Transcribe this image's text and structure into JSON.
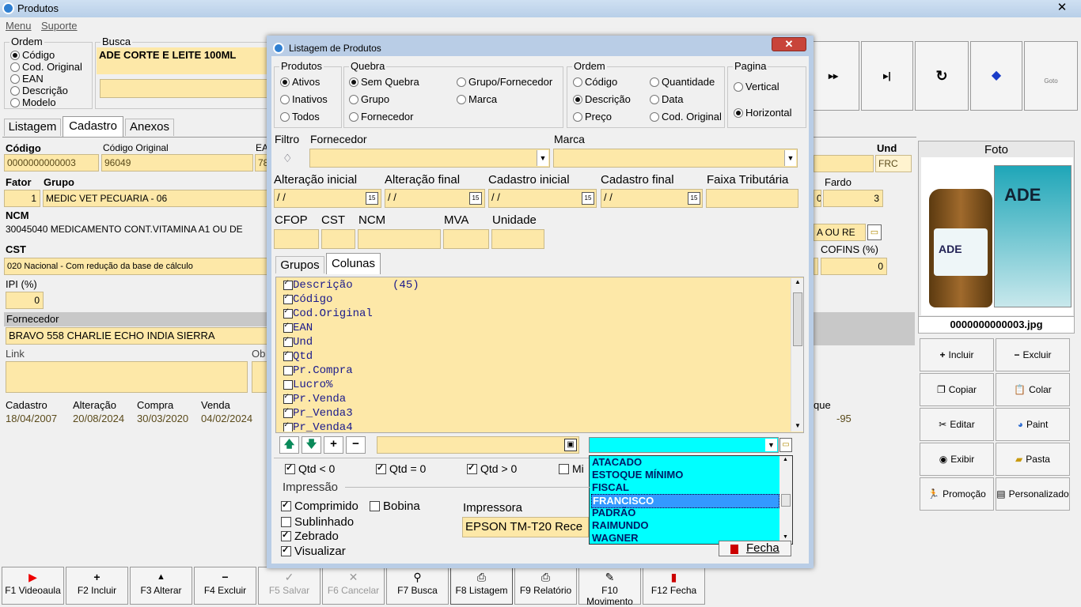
{
  "main": {
    "title": "Produtos",
    "menu": [
      "Menu",
      "Suporte"
    ],
    "ordem": {
      "label": "Ordem",
      "options": [
        "Código",
        "Cod. Original",
        "EAN",
        "Descrição",
        "Modelo"
      ],
      "selected": 0
    },
    "busca": {
      "label": "Busca",
      "value": "ADE CORTE E LEITE 100ML"
    },
    "tabs": [
      "Listagem",
      "Cadastro",
      "Anexos"
    ],
    "active_tab": 1,
    "fields": {
      "codigo": {
        "label": "Código",
        "value": "0000000000003"
      },
      "codigo_original": {
        "label": "Código Original",
        "value": "96049"
      },
      "ean": {
        "label": "EA",
        "value": "78"
      },
      "und": {
        "label": "Und",
        "value": "FRC"
      },
      "fator": {
        "label": "Fator",
        "value": "1"
      },
      "grupo": {
        "label": "Grupo",
        "value": "MEDIC VET PECUARIA - 06"
      },
      "fardo": {
        "label": "Fardo",
        "value": "3",
        "left_value": "0"
      },
      "ncm": {
        "label": "NCM",
        "value": "30045040 MEDICAMENTO CONT.VITAMINA A1 OU DE"
      },
      "ncm_right": "A OU RE",
      "cst": {
        "label": "CST",
        "value": "020 Nacional - Com redução da base de cálculo"
      },
      "cofins": {
        "label": "COFINS (%)",
        "value": "0"
      },
      "ipi": {
        "label": "IPI (%)",
        "value": "0"
      },
      "fornecedor": {
        "label": "Fornecedor",
        "value": "BRAVO 558 CHARLIE ECHO INDIA SIERRA"
      },
      "link": {
        "label": "Link",
        "value": ""
      },
      "obs_label": "Ob",
      "cadastro": {
        "label": "Cadastro",
        "value": "18/04/2007"
      },
      "alteracao": {
        "label": "Alteração",
        "value": "20/08/2024"
      },
      "compra": {
        "label": "Compra",
        "value": "30/03/2020"
      },
      "venda": {
        "label": "Venda",
        "value": "04/02/2024"
      },
      "estoque": {
        "label": "que",
        "value": "-95"
      }
    },
    "foto": {
      "label": "Foto",
      "filename": "0000000000003.jpg",
      "product_text": "ADE"
    },
    "foto_buttons": [
      {
        "label": "Incluir",
        "icon": "plus-icon"
      },
      {
        "label": "Excluir",
        "icon": "minus-icon"
      },
      {
        "label": "Copiar",
        "icon": "copy-icon"
      },
      {
        "label": "Colar",
        "icon": "paste-icon"
      },
      {
        "label": "Editar",
        "icon": "scissors-icon"
      },
      {
        "label": "Paint",
        "icon": "palette-icon"
      },
      {
        "label": "Exibir",
        "icon": "eye-icon"
      },
      {
        "label": "Pasta",
        "icon": "folder-icon"
      },
      {
        "label": "Promoção",
        "icon": "runner-icon"
      },
      {
        "label": "Personalizado",
        "icon": "card-icon"
      }
    ],
    "nav_buttons": [
      {
        "icon": "next-icon",
        "glyph": "▸▸"
      },
      {
        "icon": "last-icon",
        "glyph": "▸|"
      },
      {
        "icon": "refresh-icon",
        "glyph": "↻"
      },
      {
        "icon": "eraser-icon",
        "glyph": "◆"
      },
      {
        "icon": "goto-icon",
        "glyph": "Goto"
      }
    ],
    "function_keys": [
      {
        "label": "F1 Videoaula",
        "icon": "▶",
        "enabled": true
      },
      {
        "label": "F2 Incluir",
        "icon": "+",
        "enabled": true
      },
      {
        "label": "F3 Alterar",
        "icon": "▲",
        "enabled": true
      },
      {
        "label": "F4 Excluir",
        "icon": "−",
        "enabled": true
      },
      {
        "label": "F5 Salvar",
        "icon": "✓",
        "enabled": false
      },
      {
        "label": "F6 Cancelar",
        "icon": "✕",
        "enabled": false
      },
      {
        "label": "F7 Busca",
        "icon": "⚲",
        "enabled": true
      },
      {
        "label": "F8 Listagem",
        "icon": "⎙",
        "enabled": true
      },
      {
        "label": "F9 Relatório",
        "icon": "⎙",
        "enabled": true
      },
      {
        "label": "F10 Movimento",
        "icon": "✎",
        "enabled": true
      },
      {
        "label": "F12 Fecha",
        "icon": "▮",
        "enabled": true
      }
    ]
  },
  "dialog": {
    "title": "Listagem de Produtos",
    "produtos": {
      "label": "Produtos",
      "options": [
        "Ativos",
        "Inativos",
        "Todos"
      ],
      "selected": 0
    },
    "quebra": {
      "label": "Quebra",
      "options": [
        "Sem Quebra",
        "Grupo",
        "Fornecedor",
        "Grupo/Fornecedor",
        "Marca"
      ],
      "selected": 0
    },
    "ordem": {
      "label": "Ordem",
      "options": [
        "Código",
        "Descrição",
        "Preço",
        "Quantidade",
        "Data",
        "Cod. Original"
      ],
      "selected": 1
    },
    "pagina": {
      "label": "Pagina",
      "options": [
        "Vertical",
        "Horizontal"
      ],
      "selected": 1
    },
    "filtro_label": "Filtro",
    "fornecedor_label": "Fornecedor",
    "marca_label": "Marca",
    "date_fields": [
      {
        "label": "Alteração inicial",
        "value": "/ /"
      },
      {
        "label": "Alteração final",
        "value": "/ /"
      },
      {
        "label": "Cadastro inicial",
        "value": "/ /"
      },
      {
        "label": "Cadastro final",
        "value": "/ /"
      }
    ],
    "faixa_label": "Faixa Tributária",
    "small_fields": [
      "CFOP",
      "CST",
      "NCM",
      "MVA",
      "Unidade"
    ],
    "tabs": [
      "Grupos",
      "Colunas"
    ],
    "active_tab": 1,
    "columns": [
      {
        "label": "Descrição      (45)",
        "checked": true
      },
      {
        "label": "Código",
        "checked": true
      },
      {
        "label": "Cod.Original",
        "checked": true
      },
      {
        "label": "EAN",
        "checked": true
      },
      {
        "label": "Und",
        "checked": true
      },
      {
        "label": "Qtd",
        "checked": true
      },
      {
        "label": "Pr.Compra",
        "checked": false
      },
      {
        "label": "Lucro%",
        "checked": false
      },
      {
        "label": "Pr.Venda",
        "checked": true
      },
      {
        "label": "Pr_Venda3",
        "checked": true
      },
      {
        "label": "Pr_Venda4",
        "checked": true
      }
    ],
    "qtd_filters": [
      {
        "label": "Qtd < 0",
        "checked": true
      },
      {
        "label": "Qtd = 0",
        "checked": true
      },
      {
        "label": "Qtd > 0",
        "checked": true
      },
      {
        "label": "Mi",
        "checked": false
      }
    ],
    "impressao": {
      "label": "Impressão",
      "options": [
        {
          "label": "Comprimido",
          "checked": true
        },
        {
          "label": "Bobina",
          "checked": false
        },
        {
          "label": "Sublinhado",
          "checked": false
        },
        {
          "label": "Zebrado",
          "checked": true
        },
        {
          "label": "Visualizar",
          "checked": true
        }
      ]
    },
    "impressora": {
      "label": "Impressora",
      "value": "EPSON TM-T20 Rece"
    },
    "fecha_label": "Fecha",
    "dropdown": {
      "items": [
        "ATACADO",
        "ESTOQUE MÍNIMO",
        "FISCAL",
        "FRANCISCO",
        "PADRÃO",
        "RAIMUNDO",
        "WAGNER"
      ],
      "selected": 3
    }
  },
  "colors": {
    "field": "#fde8a8",
    "dropdown": "#00ffff",
    "dropdown_selected": "#3399ff",
    "title_text": "#1a1a8c"
  }
}
